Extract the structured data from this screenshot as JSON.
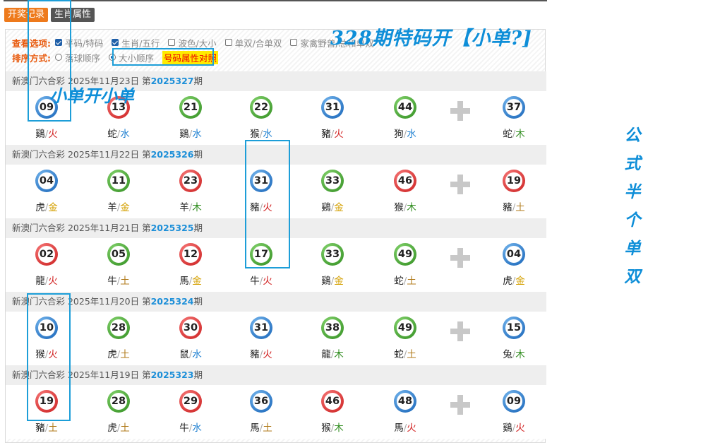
{
  "tabs": [
    {
      "label": "开奖记录",
      "active": true
    },
    {
      "label": "生肖属性",
      "active": false
    }
  ],
  "options": {
    "view_label": "查看选项:",
    "view_items": [
      {
        "label": "平码/特码",
        "checked": true
      },
      {
        "label": "生肖/五行",
        "checked": true
      },
      {
        "label": "波色/大小",
        "checked": false
      },
      {
        "label": "单双/合单双",
        "checked": false
      },
      {
        "label": "家禽野兽/总和单双",
        "checked": false
      }
    ],
    "sort_label": "排序方式:",
    "sort_items": [
      {
        "label": "落球顺序",
        "checked": false
      },
      {
        "label": "大小顺序",
        "checked": true
      }
    ],
    "compare_link": "号码属性对照"
  },
  "draws": [
    {
      "header_prefix": "新澳门六合彩 2025年11月23日 第",
      "issue": "2025327",
      "suffix": "期",
      "balls": [
        {
          "num": "09",
          "color": "blue",
          "zodiac": "鷄",
          "element": "火"
        },
        {
          "num": "13",
          "color": "red",
          "zodiac": "蛇",
          "element": "水"
        },
        {
          "num": "21",
          "color": "green",
          "zodiac": "鷄",
          "element": "水"
        },
        {
          "num": "22",
          "color": "green",
          "zodiac": "猴",
          "element": "水"
        },
        {
          "num": "31",
          "color": "blue",
          "zodiac": "豬",
          "element": "火"
        },
        {
          "num": "44",
          "color": "green",
          "zodiac": "狗",
          "element": "水"
        }
      ],
      "special": {
        "num": "37",
        "color": "blue",
        "zodiac": "蛇",
        "element": "木"
      }
    },
    {
      "header_prefix": "新澳门六合彩 2025年11月22日 第",
      "issue": "2025326",
      "suffix": "期",
      "balls": [
        {
          "num": "04",
          "color": "blue",
          "zodiac": "虎",
          "element": "金"
        },
        {
          "num": "11",
          "color": "green",
          "zodiac": "羊",
          "element": "金"
        },
        {
          "num": "23",
          "color": "red",
          "zodiac": "羊",
          "element": "木"
        },
        {
          "num": "31",
          "color": "blue",
          "zodiac": "豬",
          "element": "火"
        },
        {
          "num": "33",
          "color": "green",
          "zodiac": "鷄",
          "element": "金"
        },
        {
          "num": "46",
          "color": "red",
          "zodiac": "猴",
          "element": "木"
        }
      ],
      "special": {
        "num": "19",
        "color": "red",
        "zodiac": "豬",
        "element": "土"
      }
    },
    {
      "header_prefix": "新澳门六合彩 2025年11月21日 第",
      "issue": "2025325",
      "suffix": "期",
      "balls": [
        {
          "num": "02",
          "color": "red",
          "zodiac": "龍",
          "element": "火"
        },
        {
          "num": "05",
          "color": "green",
          "zodiac": "牛",
          "element": "土"
        },
        {
          "num": "12",
          "color": "red",
          "zodiac": "馬",
          "element": "金"
        },
        {
          "num": "17",
          "color": "green",
          "zodiac": "牛",
          "element": "火"
        },
        {
          "num": "33",
          "color": "green",
          "zodiac": "鷄",
          "element": "金"
        },
        {
          "num": "49",
          "color": "green",
          "zodiac": "蛇",
          "element": "土"
        }
      ],
      "special": {
        "num": "04",
        "color": "blue",
        "zodiac": "虎",
        "element": "金"
      }
    },
    {
      "header_prefix": "新澳门六合彩 2025年11月20日 第",
      "issue": "2025324",
      "suffix": "期",
      "balls": [
        {
          "num": "10",
          "color": "blue",
          "zodiac": "猴",
          "element": "火"
        },
        {
          "num": "28",
          "color": "green",
          "zodiac": "虎",
          "element": "土"
        },
        {
          "num": "30",
          "color": "red",
          "zodiac": "鼠",
          "element": "水"
        },
        {
          "num": "31",
          "color": "blue",
          "zodiac": "豬",
          "element": "火"
        },
        {
          "num": "38",
          "color": "green",
          "zodiac": "龍",
          "element": "木"
        },
        {
          "num": "49",
          "color": "green",
          "zodiac": "蛇",
          "element": "土"
        }
      ],
      "special": {
        "num": "15",
        "color": "blue",
        "zodiac": "兔",
        "element": "木"
      }
    },
    {
      "header_prefix": "新澳门六合彩 2025年11月19日 第",
      "issue": "2025323",
      "suffix": "期",
      "balls": [
        {
          "num": "19",
          "color": "red",
          "zodiac": "豬",
          "element": "土"
        },
        {
          "num": "28",
          "color": "green",
          "zodiac": "虎",
          "element": "土"
        },
        {
          "num": "29",
          "color": "red",
          "zodiac": "牛",
          "element": "水"
        },
        {
          "num": "36",
          "color": "blue",
          "zodiac": "馬",
          "element": "土"
        },
        {
          "num": "46",
          "color": "red",
          "zodiac": "猴",
          "element": "木"
        },
        {
          "num": "48",
          "color": "blue",
          "zodiac": "馬",
          "element": "火"
        }
      ],
      "special": {
        "num": "09",
        "color": "blue",
        "zodiac": "鷄",
        "element": "火"
      }
    }
  ],
  "element_colors": {
    "金": "#d4a000",
    "木": "#2f8c1e",
    "水": "#1d7fd0",
    "火": "#d01c1c",
    "土": "#b07a1a"
  },
  "annotations": {
    "headline": "328期特码开【小单?]",
    "note": "小单开小单",
    "vertical": [
      "公",
      "式",
      "半",
      "个",
      "单",
      "双"
    ]
  }
}
